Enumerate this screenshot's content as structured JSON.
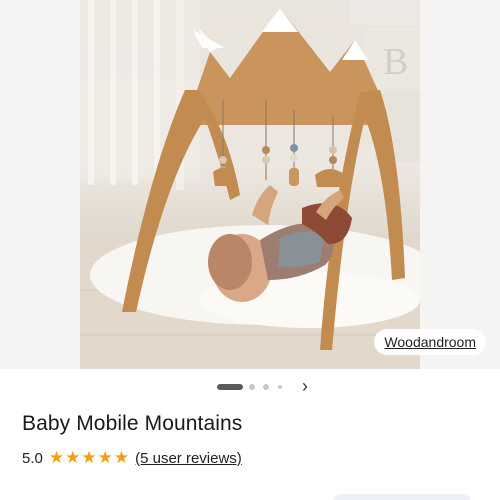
{
  "listing": {
    "title": "Baby Mobile Mountains",
    "rating_value": "5.0",
    "star_count": 5,
    "reviews_link": "(5 user reviews)"
  },
  "image": {
    "shop_name": "Woodandroom",
    "carousel": {
      "active_index": 0,
      "dot_count": 4
    },
    "next_icon": "chevron-right-icon"
  },
  "icons": {
    "star": "★",
    "next": "›"
  },
  "colors": {
    "star": "#f1a10d",
    "active_dot": "#5a5a5a",
    "inactive_dot": "#c8c8c8"
  }
}
